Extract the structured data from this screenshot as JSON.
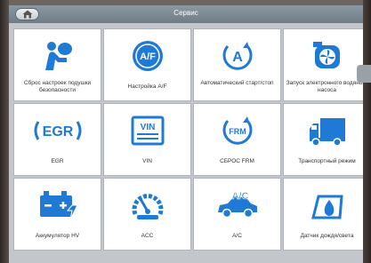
{
  "header": {
    "title": "Сервис",
    "home_label": "home"
  },
  "colors": {
    "icon_blue": "#1f7ad6",
    "header_bg": "#7d8a94",
    "tile_bg": "#ffffff"
  },
  "tiles": [
    {
      "label": "Сброс настроек подушки безопасности",
      "icon": "airbag-icon"
    },
    {
      "label": "Настройка A/F",
      "icon": "af-icon",
      "icon_text": "A/F"
    },
    {
      "label": "Автоматический старт/стоп",
      "icon": "auto-start-stop-icon",
      "icon_text": "A"
    },
    {
      "label": "Запуск электронного водяного насоса",
      "icon": "water-pump-icon"
    },
    {
      "label": "EGR",
      "icon": "egr-icon",
      "icon_text": "EGR"
    },
    {
      "label": "VIN",
      "icon": "vin-icon",
      "icon_text": "VIN"
    },
    {
      "label": "СБРОС FRM",
      "icon": "frm-icon",
      "icon_text": "FRM"
    },
    {
      "label": "Транспортный режим",
      "icon": "truck-icon"
    },
    {
      "label": "Аккумулятор HV",
      "icon": "battery-icon"
    },
    {
      "label": "ACC",
      "icon": "acc-icon"
    },
    {
      "label": "A/C",
      "icon": "ac-car-icon",
      "icon_text": "A/C"
    },
    {
      "label": "Датчик дождя/света",
      "icon": "rain-sensor-icon"
    }
  ]
}
